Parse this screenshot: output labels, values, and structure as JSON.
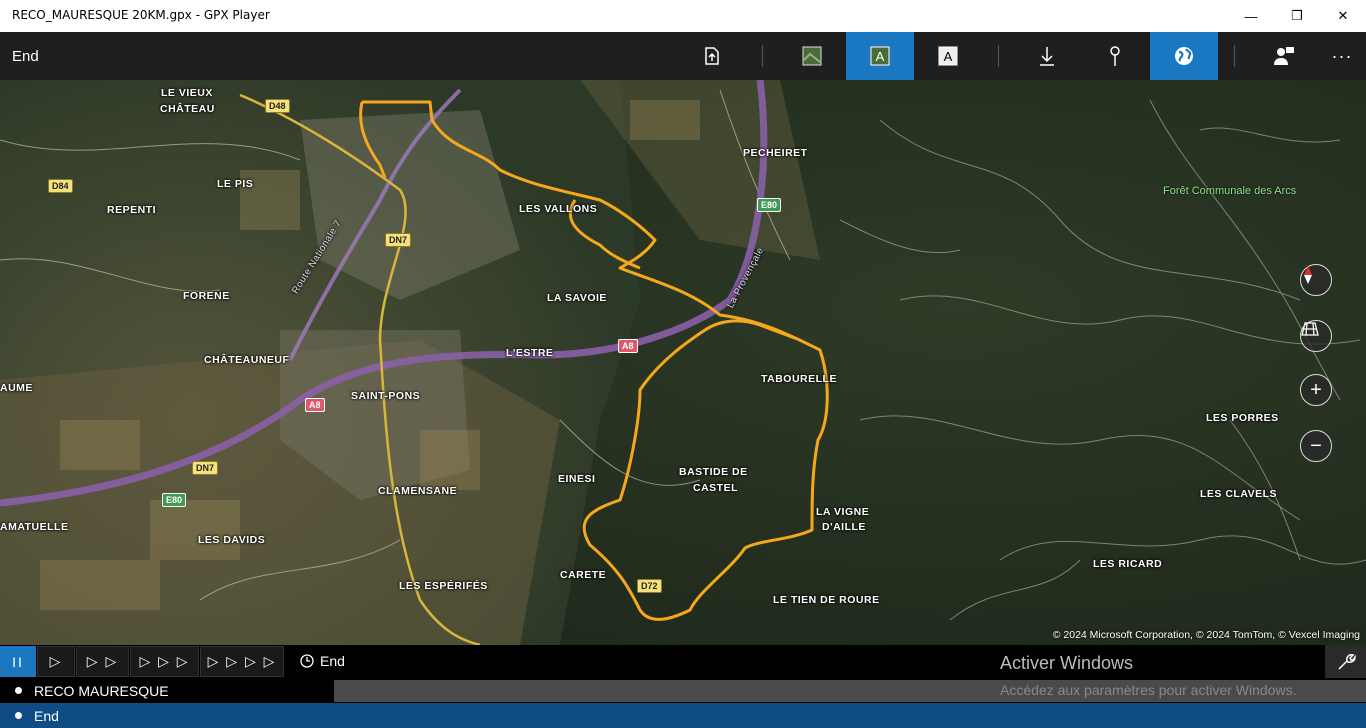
{
  "window": {
    "title": "RECO_MAURESQUE 20KM.gpx - GPX Player",
    "minimize": "—",
    "maximize": "❐",
    "close": "✕"
  },
  "toolbar": {
    "label": "End",
    "buttons": [
      {
        "name": "export-icon",
        "active": false
      },
      {
        "name": "aerial-map-icon",
        "active": false
      },
      {
        "name": "aerial-labels-icon",
        "active": true
      },
      {
        "name": "road-map-icon",
        "active": false
      },
      {
        "name": "download-icon",
        "active": false
      },
      {
        "name": "pin-icon",
        "active": false
      },
      {
        "name": "globe-icon",
        "active": true
      },
      {
        "name": "people-icon",
        "active": false
      },
      {
        "name": "more-icon",
        "active": false
      }
    ],
    "more": "···"
  },
  "map": {
    "labels": {
      "le_vieux": "LE VIEUX",
      "chateau": "CHÂTEAU",
      "le_pis": "LE PIS",
      "repenti": "REPENTI",
      "forene": "FORENE",
      "chateauneuf": "CHÂTEAUNEUF",
      "aume": "AUME",
      "saint_pons": "SAINT-PONS",
      "lestre": "L'ESTRE",
      "clamensane": "CLAMENSANE",
      "amatuelle": "AMATUELLE",
      "les_davids": "LES DAVIDS",
      "les_esperifes": "LES ESPÉRIFÉS",
      "carete": "CARETE",
      "einesi": "EINESI",
      "bastide": "BASTIDE DE",
      "castel": "CASTEL",
      "les_vallons": "LES VALLONS",
      "la_savoie": "LA SAVOIE",
      "pecheiret": "PECHEIRET",
      "tabourelle": "TABOURELLE",
      "la_vigne": "LA VIGNE",
      "daille": "D'AILLE",
      "le_tien": "LE TIEN DE ROURE",
      "les_porres": "LES PORRES",
      "les_clavels": "LES CLAVELS",
      "les_ricard": "LES RICARD",
      "foret": "Forêt Communale des Arcs",
      "route_nationale": "Route Nationale 7",
      "la_provencale": "La Provençale"
    },
    "badges": {
      "d48": "D48",
      "d84": "D84",
      "dn7a": "DN7",
      "dn7b": "DN7",
      "e80a": "E80",
      "e80b": "E80",
      "a8a": "A8",
      "a8b": "A8",
      "d72": "D72"
    },
    "copyright": "© 2024 Microsoft Corporation, © 2024 TomTom, © Vexcel Imaging",
    "controls": {
      "zoom_in": "+",
      "zoom_out": "−"
    },
    "colors": {
      "track": "#f5a81c",
      "highway": "#8a5fa8",
      "main_road": "#d9b53a"
    }
  },
  "playback": {
    "pause": "II",
    "speed1": "▷",
    "speed2": "▷ ▷",
    "speed3": "▷ ▷ ▷",
    "speed4": "▷ ▷ ▷ ▷",
    "end_label": "End",
    "activate_title": "Activer Windows",
    "activate_sub": "Accédez aux paramètres pour activer Windows."
  },
  "tracks": [
    {
      "label": "RECO MAURESQUE"
    },
    {
      "label": "End"
    }
  ]
}
